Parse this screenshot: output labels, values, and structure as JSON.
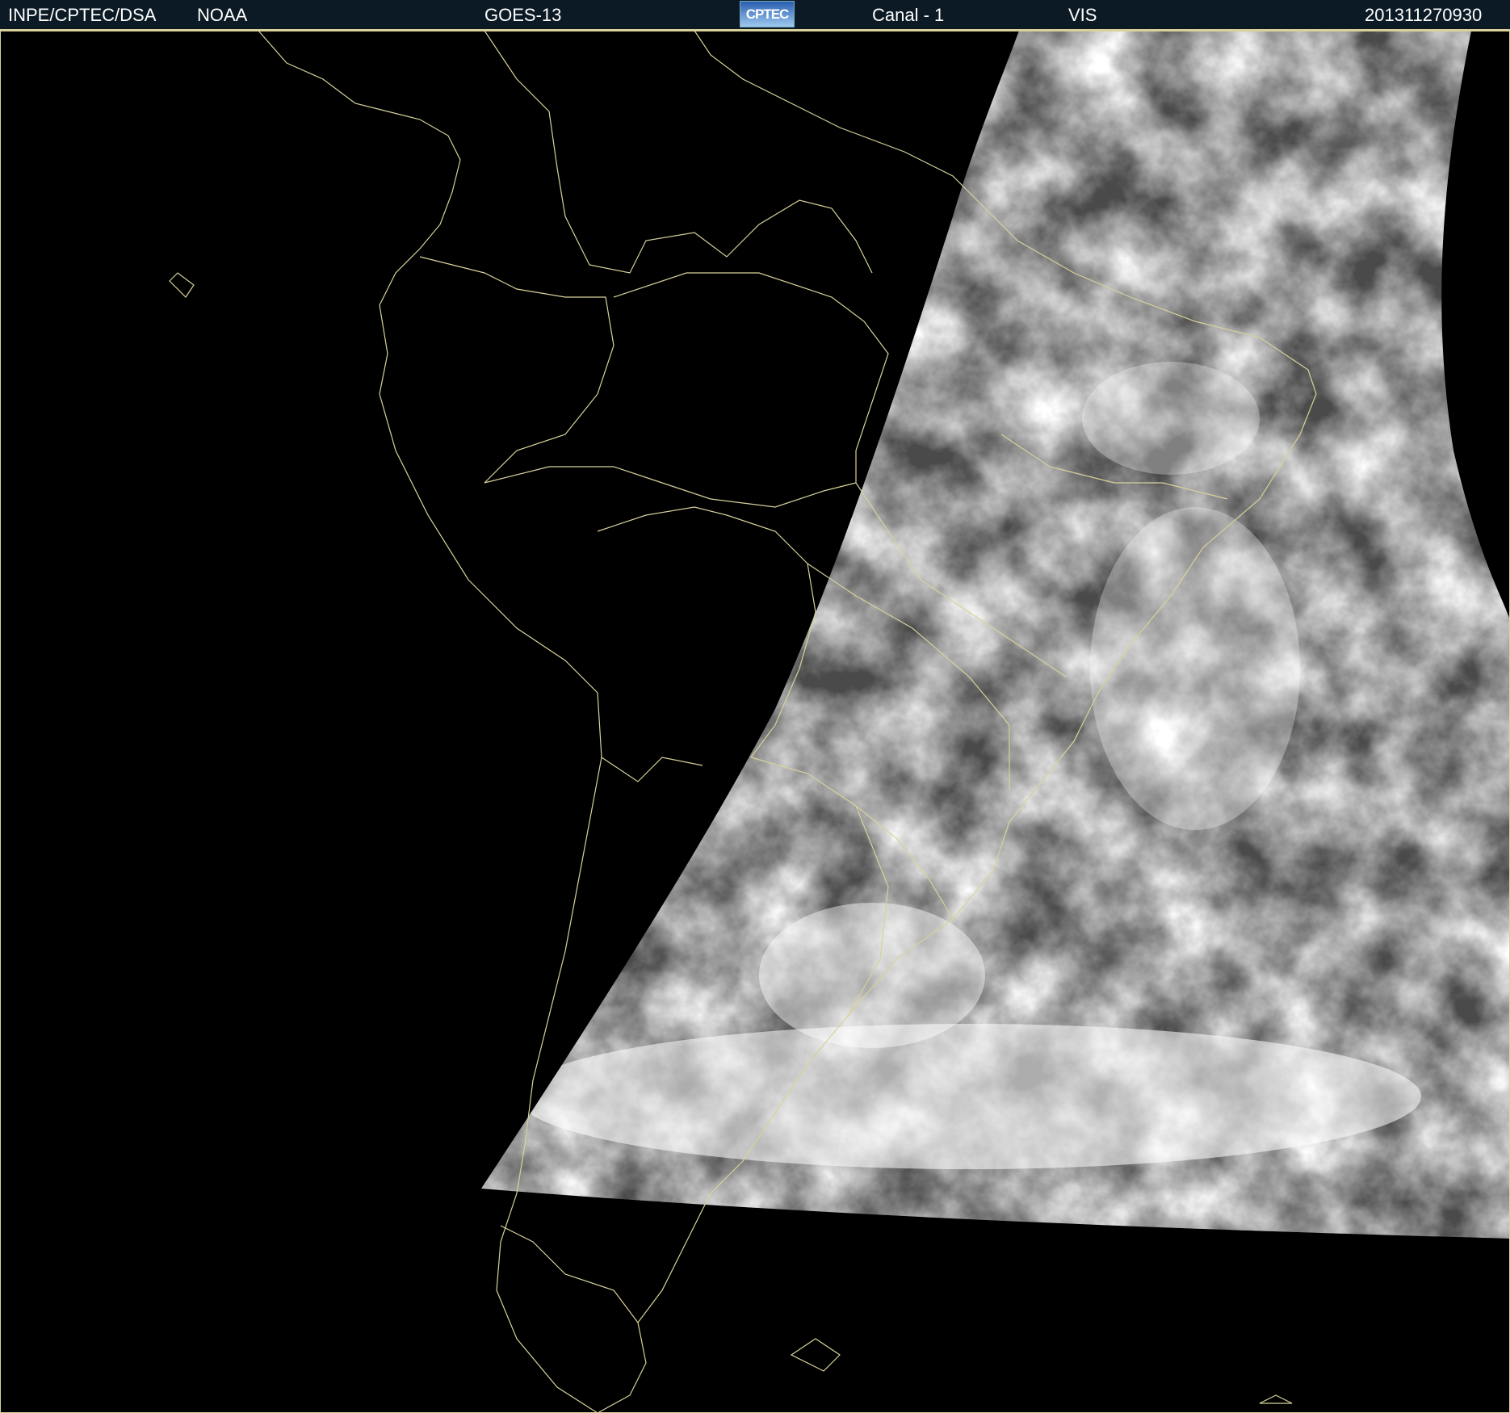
{
  "header": {
    "source": "INPE/CPTEC/DSA",
    "agency": "NOAA",
    "satellite": "GOES-13",
    "logo_text": "CPTEC",
    "channel": "Canal - 1",
    "band": "VIS",
    "timestamp": "201311270930"
  },
  "colors": {
    "background": "#000000",
    "header_bar": "#0b1a24",
    "border_lines": "#d8d29a",
    "text": "#ffffff"
  }
}
